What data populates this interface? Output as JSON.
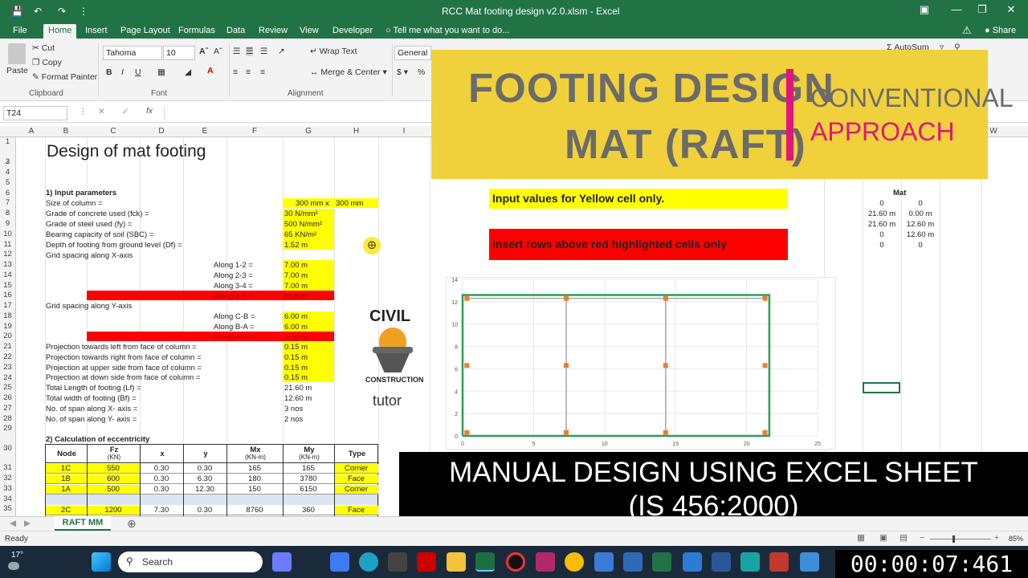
{
  "titlebar": {
    "title": "RCC Mat footing design v2.0.xlsm - Excel"
  },
  "tabs": [
    "File",
    "Home",
    "Insert",
    "Page Layout",
    "Formulas",
    "Data",
    "Review",
    "View",
    "Developer",
    "Tell me what you want to do..."
  ],
  "ribbon": {
    "paste": "Paste",
    "cut": "Cut",
    "copy": "Copy",
    "format_painter": "Format Painter",
    "clipboard": "Clipboard",
    "font_name": "Tahoma",
    "font_size": "10",
    "font": "Font",
    "wrap_text": "Wrap Text",
    "merge_center": "Merge & Center",
    "alignment": "Alignment",
    "number_format": "General",
    "autosum": "AutoSum",
    "share": "Share",
    "bold": "B",
    "italic": "I",
    "underline": "U"
  },
  "formula_bar": {
    "name_box": "T24",
    "fx": "fx"
  },
  "columns": [
    "A",
    "B",
    "C",
    "D",
    "E",
    "F",
    "G",
    "H",
    "I",
    "W"
  ],
  "rows": [
    "1",
    "2",
    "3",
    "4",
    "5",
    "6",
    "7",
    "8",
    "9",
    "10",
    "11",
    "12",
    "13",
    "14",
    "15",
    "16",
    "17",
    "18",
    "19",
    "20",
    "21",
    "22",
    "23",
    "24",
    "25",
    "26",
    "27",
    "28",
    "29",
    "30",
    "31",
    "32",
    "33",
    "34",
    "35"
  ],
  "sheet": {
    "title": "Design of mat footing",
    "sec1": "1) Input parameters",
    "r6": "Size of column =",
    "r6v1": "300 mm x",
    "r6v2": "300 mm",
    "r7": "Grade of concrete used (fck) =",
    "r7v": "30 N/mm²",
    "r8": "Grade of steel used (fy) =",
    "r8v": "500 N/mm²",
    "r9": "Bearing capacity of soil (SBC) =",
    "r9v": "65 KN/m²",
    "r10": "Depth of footing from ground level (Df) =",
    "r10v": "1.52 m",
    "r11": "Grid spacing along X-axis",
    "r12": "Along 1-2 =",
    "r12v": "7.00 m",
    "r13": "Along 2-3 =",
    "r13v": "7.00 m",
    "r14": "Along 3-4 =",
    "r14v": "7.00 m",
    "r15": "Along 4-5 =",
    "r15v": "0.00 m",
    "r16": "Grid spacing along Y-axis",
    "r17": "Along C-B =",
    "r17v": "6.00 m",
    "r18": "Along B-A =",
    "r18v": "6.00 m",
    "r19": "Along A-0 =",
    "r19v": "0.00 m",
    "r20": "Projection towards left from face of column =",
    "r20v": "0.15 m",
    "r21": "Projection towards right from face of column =",
    "r21v": "0.15 m",
    "r22": "Projection at upper side from face of column =",
    "r22v": "0.15 m",
    "r23": "Projection at down side from face of column =",
    "r23v": "0.15 m",
    "r24": "Total Length of footing (Lf) =",
    "r24v": "21.60 m",
    "r25": "Total width of footing (Bf) =",
    "r25v": "12.60 m",
    "r26": "No. of span along X- axis =",
    "r26v": "3 nos",
    "r27": "No. of span along Y- axis =",
    "r27v": "2 nos",
    "sec2": "2) Calculation of eccentricity",
    "table": {
      "headers": [
        "Node",
        "Fz",
        "(KN)",
        "x",
        "y",
        "Mx",
        "(KN-m)",
        "My",
        "(KN-m)",
        "Type"
      ],
      "rows": [
        [
          "1C",
          "550",
          "0.30",
          "0.30",
          "165",
          "165",
          "Corner"
        ],
        [
          "1B",
          "600",
          "0.30",
          "6.30",
          "180",
          "3780",
          "Face"
        ],
        [
          "1A",
          "500",
          "0.30",
          "12.30",
          "150",
          "6150",
          "Corner"
        ],
        [
          "2C",
          "1200",
          "7.30",
          "0.30",
          "8760",
          "360",
          "Face"
        ]
      ]
    },
    "input_note": "Input values for Yellow cell only.",
    "insert_note": "Insert rows above red highlighted cells only",
    "mat_header": "Mat",
    "mat": [
      [
        "0",
        "0"
      ],
      [
        "21.60 m",
        "0.00 m"
      ],
      [
        "21.60 m",
        "12.60 m"
      ],
      [
        "0",
        "12.60 m"
      ],
      [
        "0",
        "0"
      ]
    ]
  },
  "chart_data": {
    "type": "scatter",
    "xlim": [
      0,
      25
    ],
    "ylim": [
      0,
      14
    ],
    "xticks": [
      "0",
      "5",
      "10",
      "15",
      "20",
      "25"
    ],
    "yticks": [
      "0",
      "2",
      "4",
      "6",
      "8",
      "10",
      "12",
      "14"
    ],
    "series": [
      {
        "values": [
          [
            0.3,
            0.3
          ],
          [
            7.3,
            0.3
          ],
          [
            14.3,
            0.3
          ],
          [
            21.3,
            0.3
          ],
          [
            0.3,
            6.3
          ],
          [
            7.3,
            6.3
          ],
          [
            14.3,
            6.3
          ],
          [
            21.3,
            6.3
          ],
          [
            0.3,
            12.3
          ],
          [
            7.3,
            12.3
          ],
          [
            14.3,
            12.3
          ],
          [
            21.3,
            12.3
          ]
        ],
        "color": "#ed7d31"
      }
    ],
    "outline": [
      [
        0,
        0
      ],
      [
        21.6,
        0
      ],
      [
        21.6,
        12.6
      ],
      [
        0,
        12.6
      ],
      [
        0,
        0
      ]
    ]
  },
  "logo": {
    "line1": "CIVIL",
    "line2": "CONSTRUCTION",
    "line3": "tutor"
  },
  "banner": {
    "line1": "FOOTING DESIGN",
    "line2": "MAT (RAFT)",
    "right1": "CONVENTIONAL",
    "right2": "APPROACH"
  },
  "manual": {
    "line1": "MANUAL DESIGN USING EXCEL SHEET",
    "line2": "(IS 456:2000)"
  },
  "sheettab": "RAFT MM",
  "status": {
    "ready": "Ready",
    "zoom": "85%"
  },
  "taskbar": {
    "temp": "17°",
    "search": "Search"
  },
  "timer": "00:00:07:461"
}
